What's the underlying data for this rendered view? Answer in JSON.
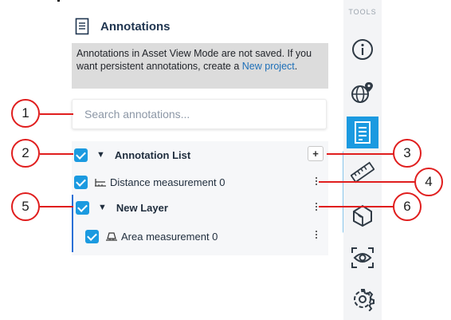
{
  "panel": {
    "title": "Annotations",
    "notice_text": "Annotations in Asset View Mode are not saved. If you want persistent annotations, create a ",
    "notice_link": "New project",
    "notice_end": "."
  },
  "search": {
    "placeholder": "Search annotations..."
  },
  "tree": {
    "list_title": "Annotation List",
    "add_label": "+",
    "items": [
      {
        "label": "Distance measurement 0",
        "icon": "ruler-measure-icon"
      },
      {
        "label": "New Layer",
        "icon": ""
      },
      {
        "label": "Area measurement 0",
        "icon": "area-measure-icon"
      }
    ]
  },
  "toolbar": {
    "label": "TOOLS",
    "buttons": [
      "info-icon",
      "globe-pin-icon",
      "annotations-icon",
      "ruler-icon",
      "shape-icon",
      "eye-icon",
      "gear-icon"
    ],
    "active": "annotations-icon"
  },
  "callouts": [
    "1",
    "2",
    "3",
    "4",
    "5",
    "6"
  ],
  "colors": {
    "accent": "#1b9ae0",
    "callout": "#e01e1e",
    "layer_bar": "#2a6fd6"
  }
}
